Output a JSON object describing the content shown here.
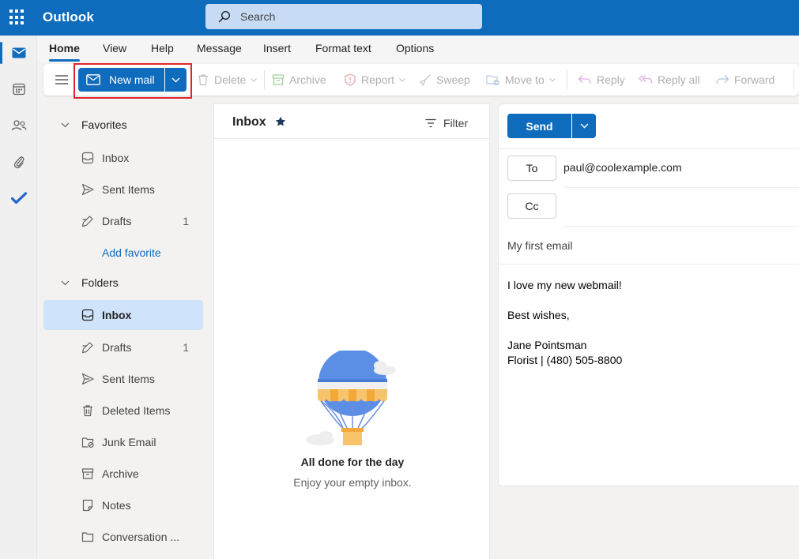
{
  "app": {
    "title": "Outlook"
  },
  "search": {
    "placeholder": "Search"
  },
  "rail": {
    "items": [
      "mail-icon",
      "calendar-icon",
      "people-icon",
      "attach-icon",
      "todo-icon"
    ]
  },
  "tabs": [
    {
      "label": "Home",
      "active": true
    },
    {
      "label": "View"
    },
    {
      "label": "Help"
    },
    {
      "label": "Message"
    },
    {
      "label": "Insert"
    },
    {
      "label": "Format text"
    },
    {
      "label": "Options"
    }
  ],
  "ribbon": {
    "new_mail": "New mail",
    "delete": "Delete",
    "archive": "Archive",
    "report": "Report",
    "sweep": "Sweep",
    "move_to": "Move to",
    "reply": "Reply",
    "reply_all": "Reply all",
    "forward": "Forward"
  },
  "folders": {
    "favorites_label": "Favorites",
    "favorites": [
      {
        "label": "Inbox",
        "count": ""
      },
      {
        "label": "Sent Items",
        "count": ""
      },
      {
        "label": "Drafts",
        "count": "1"
      }
    ],
    "add_favorite": "Add favorite",
    "folders_label": "Folders",
    "items": [
      {
        "label": "Inbox",
        "count": "",
        "selected": true
      },
      {
        "label": "Drafts",
        "count": "1"
      },
      {
        "label": "Sent Items",
        "count": ""
      },
      {
        "label": "Deleted Items",
        "count": ""
      },
      {
        "label": "Junk Email",
        "count": ""
      },
      {
        "label": "Archive",
        "count": ""
      },
      {
        "label": "Notes",
        "count": ""
      },
      {
        "label": "Conversation ...",
        "count": ""
      }
    ]
  },
  "message_list": {
    "title": "Inbox",
    "filter": "Filter",
    "empty_title": "All done for the day",
    "empty_subtitle": "Enjoy your empty inbox."
  },
  "compose": {
    "send": "Send",
    "to_label": "To",
    "to_value": "paul@coolexample.com",
    "cc_label": "Cc",
    "cc_value": "",
    "subject": "My first email",
    "body": [
      "I love my new webmail!",
      "",
      "Best wishes,",
      "",
      "Jane Pointsman",
      "Florist | (480) 505-8800"
    ]
  },
  "colors": {
    "brand": "#0f6cbd",
    "selected": "#cfe4fa",
    "highlight": "#e0252f"
  }
}
